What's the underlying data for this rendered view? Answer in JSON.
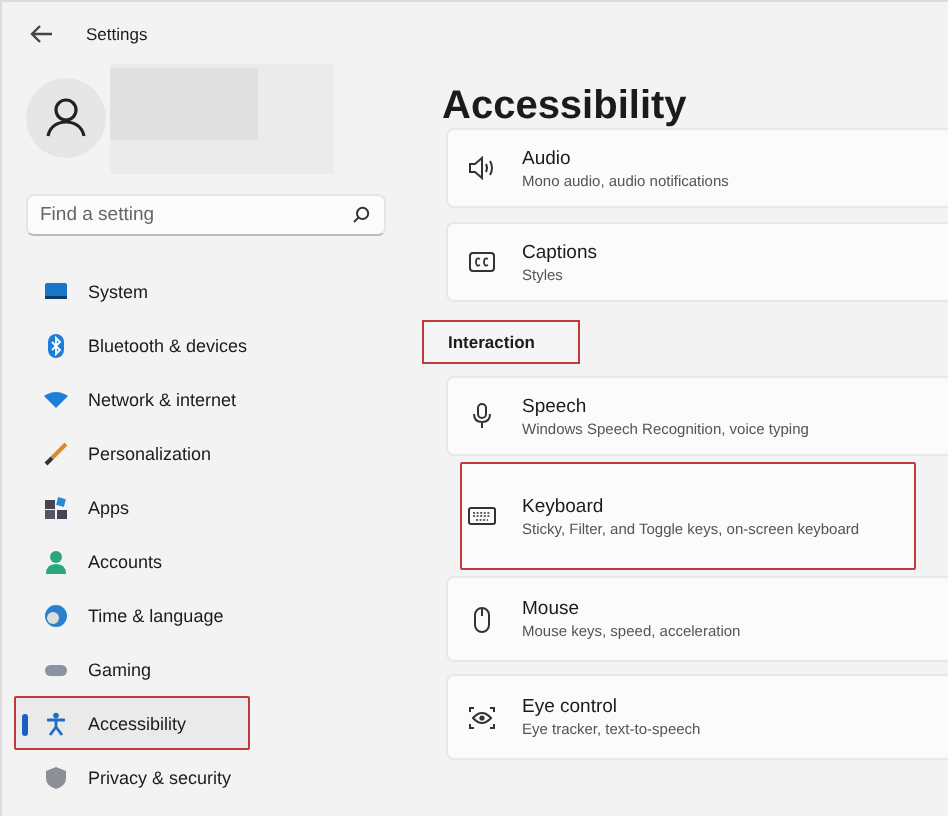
{
  "window": {
    "title": "Settings"
  },
  "search": {
    "placeholder": "Find a setting"
  },
  "sidebar": {
    "items": [
      {
        "label": "System",
        "selected": false,
        "highlighted": false
      },
      {
        "label": "Bluetooth & devices",
        "selected": false,
        "highlighted": false
      },
      {
        "label": "Network & internet",
        "selected": false,
        "highlighted": false
      },
      {
        "label": "Personalization",
        "selected": false,
        "highlighted": false
      },
      {
        "label": "Apps",
        "selected": false,
        "highlighted": false
      },
      {
        "label": "Accounts",
        "selected": false,
        "highlighted": false
      },
      {
        "label": "Time & language",
        "selected": false,
        "highlighted": false
      },
      {
        "label": "Gaming",
        "selected": false,
        "highlighted": false
      },
      {
        "label": "Accessibility",
        "selected": true,
        "highlighted": true
      },
      {
        "label": "Privacy & security",
        "selected": false,
        "highlighted": false
      }
    ]
  },
  "page": {
    "title": "Accessibility",
    "items": [
      {
        "kind": "card",
        "title": "Audio",
        "subtitle": "Mono audio, audio notifications",
        "highlighted": false
      },
      {
        "kind": "card",
        "title": "Captions",
        "subtitle": "Styles",
        "highlighted": false
      },
      {
        "kind": "header",
        "title": "Interaction",
        "highlighted": true
      },
      {
        "kind": "card",
        "title": "Speech",
        "subtitle": "Windows Speech Recognition, voice typing",
        "highlighted": false
      },
      {
        "kind": "card",
        "title": "Keyboard",
        "subtitle": "Sticky, Filter, and Toggle keys, on-screen keyboard",
        "highlighted": true
      },
      {
        "kind": "card",
        "title": "Mouse",
        "subtitle": "Mouse keys, speed, acceleration",
        "highlighted": false
      },
      {
        "kind": "card",
        "title": "Eye control",
        "subtitle": "Eye tracker, text-to-speech",
        "highlighted": false
      }
    ]
  }
}
